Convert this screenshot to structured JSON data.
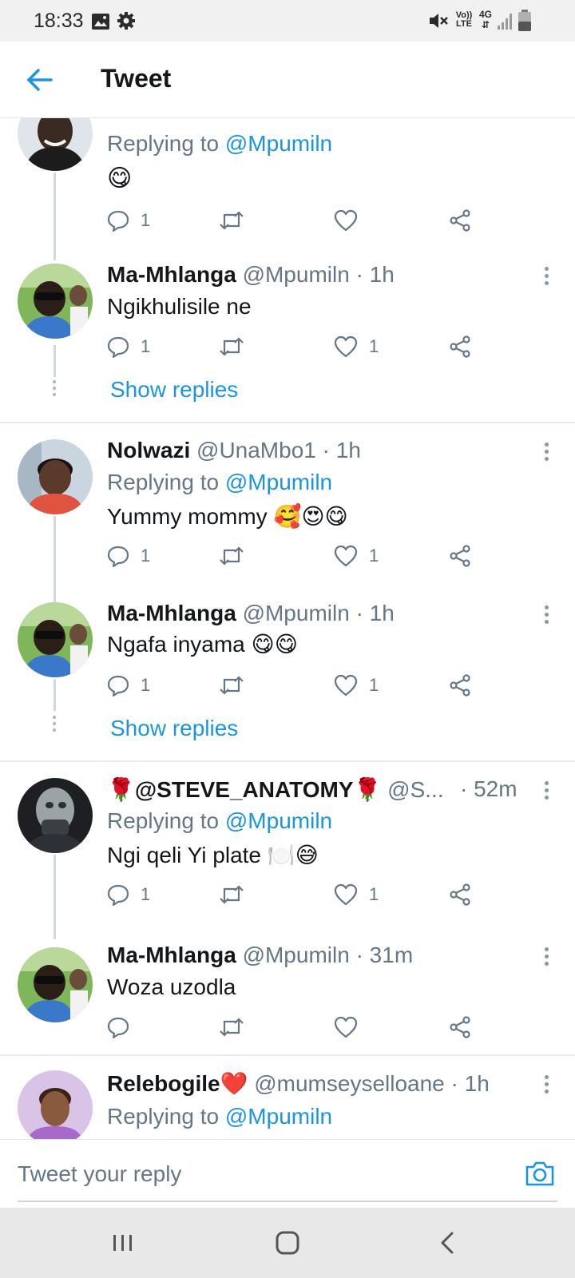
{
  "status_bar": {
    "time": "18:33",
    "icons": [
      "image-icon",
      "settings-icon",
      "mute-icon",
      "volte-icon",
      "4g-icon",
      "signal-icon",
      "battery-icon"
    ],
    "volte_label": "Vo)) LTE",
    "network_label": "4G"
  },
  "header": {
    "title": "Tweet",
    "back_icon": "arrow-left-icon"
  },
  "colors": {
    "accent": "#1b95e0",
    "text": "#14171a",
    "secondary_text": "#657786"
  },
  "tweets": [
    {
      "name": "",
      "handle": "",
      "time": "",
      "replying_label": "Replying to ",
      "replying_to": "@Mpumiln",
      "text": "😋",
      "replies": "1",
      "likes": ""
    },
    {
      "name": "Ma-Mhlanga",
      "handle": "@Mpumiln",
      "time": "· 1h",
      "text": "Ngikhulisile ne",
      "replies": "1",
      "likes": "1",
      "show_replies": "Show replies"
    },
    {
      "name": "Nolwazi",
      "handle": "@UnaMbo1",
      "time": "· 1h",
      "replying_label": "Replying to ",
      "replying_to": "@Mpumiln",
      "text": "Yummy mommy 🥰😍😋",
      "replies": "1",
      "likes": "1"
    },
    {
      "name": "Ma-Mhlanga",
      "handle": "@Mpumiln",
      "time": "· 1h",
      "text": "Ngafa inyama 😋😋",
      "replies": "1",
      "likes": "1",
      "show_replies": "Show replies"
    },
    {
      "name": "🌹@STEVE_ANATOMY🌹",
      "handle": "@S...",
      "time": "· 52m",
      "replying_label": "Replying to ",
      "replying_to": "@Mpumiln",
      "text": "Ngi qeli Yi plate 🍽️😅",
      "replies": "1",
      "likes": "1"
    },
    {
      "name": "Ma-Mhlanga",
      "handle": "@Mpumiln",
      "time": "· 31m",
      "text": "Woza uzodla",
      "replies": "",
      "likes": ""
    },
    {
      "name": "Relebogile❤️",
      "handle": "@mumseyselloane",
      "time": "· 1h",
      "replying_label": "Replying to ",
      "replying_to": "@Mpumiln"
    }
  ],
  "composer": {
    "placeholder": "Tweet your reply"
  },
  "nav": {
    "icons": [
      "recent-apps-icon",
      "home-icon",
      "back-icon"
    ]
  }
}
